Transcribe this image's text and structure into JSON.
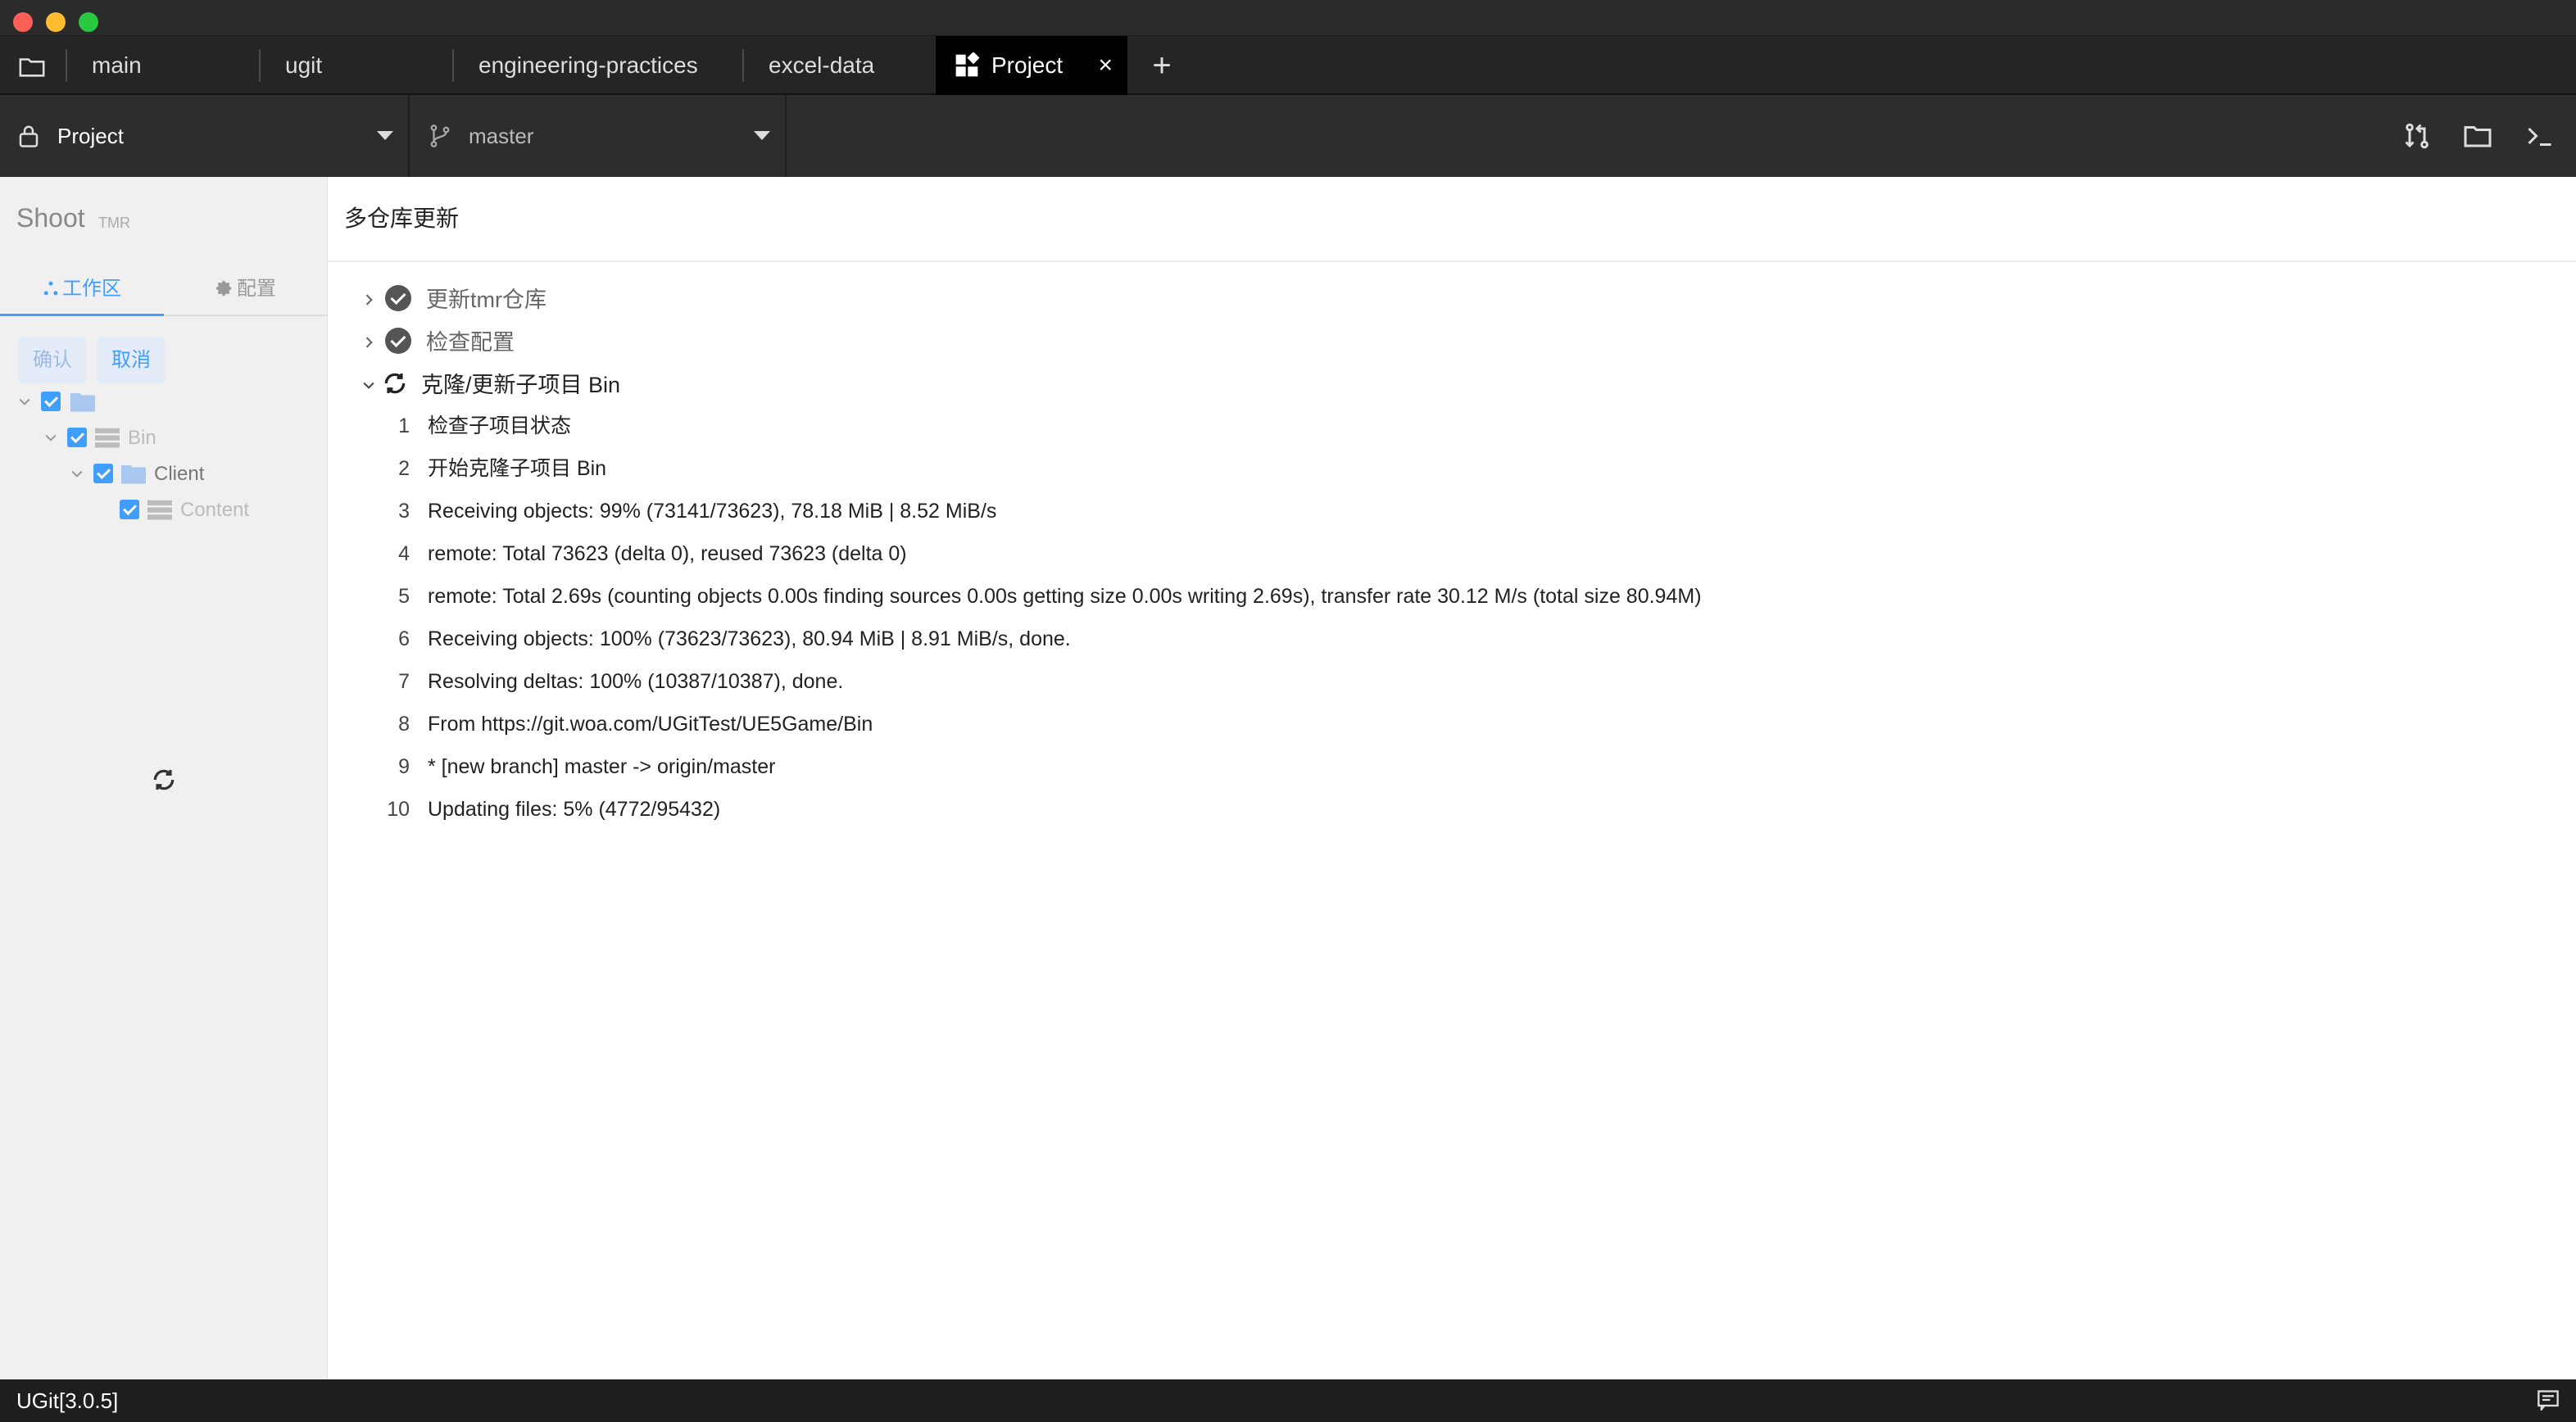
{
  "tabs": [
    {
      "label": "main"
    },
    {
      "label": "ugit"
    },
    {
      "label": "engineering-practices"
    },
    {
      "label": "excel-data"
    },
    {
      "label": "Project",
      "active": true
    }
  ],
  "tab_close": "×",
  "tab_add": "+",
  "toolbar": {
    "project": "Project",
    "branch": "master"
  },
  "sidebar": {
    "title": "Shoot",
    "subtitle": "TMR",
    "tab_workspace": "工作区",
    "tab_config": "配置",
    "confirm": "确认",
    "cancel": "取消",
    "tree": [
      {
        "label": "",
        "type": "folder"
      },
      {
        "label": "Bin",
        "type": "repo"
      },
      {
        "label": "Client",
        "type": "folder"
      },
      {
        "label": "Content",
        "type": "repo"
      }
    ]
  },
  "main": {
    "title": "多仓库更新",
    "steps": [
      {
        "label": "更新tmr仓库",
        "status": "done"
      },
      {
        "label": "检查配置",
        "status": "done"
      },
      {
        "label": "克隆/更新子项目 Bin",
        "status": "running"
      }
    ],
    "log": [
      {
        "n": "1",
        "text": "检查子项目状态"
      },
      {
        "n": "2",
        "text": "开始克隆子项目 Bin"
      },
      {
        "n": "3",
        "text": "Receiving objects: 99% (73141/73623), 78.18 MiB | 8.52 MiB/s"
      },
      {
        "n": "4",
        "text": "remote: Total 73623 (delta 0), reused 73623 (delta 0)"
      },
      {
        "n": "5",
        "text": "remote: Total 2.69s (counting objects 0.00s finding sources 0.00s getting size 0.00s writing 2.69s), transfer rate 30.12 M/s (total size 80.94M)"
      },
      {
        "n": "6",
        "text": "Receiving objects: 100% (73623/73623), 80.94 MiB | 8.91 MiB/s, done."
      },
      {
        "n": "7",
        "text": "Resolving deltas: 100% (10387/10387), done."
      },
      {
        "n": "8",
        "text": "From https://git.woa.com/UGitTest/UE5Game/Bin"
      },
      {
        "n": "9",
        "text": "* [new branch] master -> origin/master"
      },
      {
        "n": "10",
        "text": "Updating files: 5% (4772/95432)"
      }
    ]
  },
  "status": {
    "version": "UGit[3.0.5]"
  },
  "colors": {
    "accent": "#409eff",
    "tab_active_bg": "#000000",
    "toolbar_bg": "#2d2d2d"
  }
}
